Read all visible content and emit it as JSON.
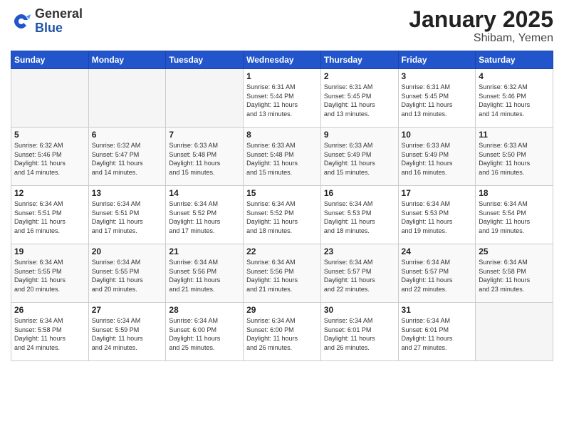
{
  "logo": {
    "general": "General",
    "blue": "Blue"
  },
  "header": {
    "month": "January 2025",
    "location": "Shibam, Yemen"
  },
  "weekdays": [
    "Sunday",
    "Monday",
    "Tuesday",
    "Wednesday",
    "Thursday",
    "Friday",
    "Saturday"
  ],
  "weeks": [
    [
      {
        "day": "",
        "info": ""
      },
      {
        "day": "",
        "info": ""
      },
      {
        "day": "",
        "info": ""
      },
      {
        "day": "1",
        "info": "Sunrise: 6:31 AM\nSunset: 5:44 PM\nDaylight: 11 hours\nand 13 minutes."
      },
      {
        "day": "2",
        "info": "Sunrise: 6:31 AM\nSunset: 5:45 PM\nDaylight: 11 hours\nand 13 minutes."
      },
      {
        "day": "3",
        "info": "Sunrise: 6:31 AM\nSunset: 5:45 PM\nDaylight: 11 hours\nand 13 minutes."
      },
      {
        "day": "4",
        "info": "Sunrise: 6:32 AM\nSunset: 5:46 PM\nDaylight: 11 hours\nand 14 minutes."
      }
    ],
    [
      {
        "day": "5",
        "info": "Sunrise: 6:32 AM\nSunset: 5:46 PM\nDaylight: 11 hours\nand 14 minutes."
      },
      {
        "day": "6",
        "info": "Sunrise: 6:32 AM\nSunset: 5:47 PM\nDaylight: 11 hours\nand 14 minutes."
      },
      {
        "day": "7",
        "info": "Sunrise: 6:33 AM\nSunset: 5:48 PM\nDaylight: 11 hours\nand 15 minutes."
      },
      {
        "day": "8",
        "info": "Sunrise: 6:33 AM\nSunset: 5:48 PM\nDaylight: 11 hours\nand 15 minutes."
      },
      {
        "day": "9",
        "info": "Sunrise: 6:33 AM\nSunset: 5:49 PM\nDaylight: 11 hours\nand 15 minutes."
      },
      {
        "day": "10",
        "info": "Sunrise: 6:33 AM\nSunset: 5:49 PM\nDaylight: 11 hours\nand 16 minutes."
      },
      {
        "day": "11",
        "info": "Sunrise: 6:33 AM\nSunset: 5:50 PM\nDaylight: 11 hours\nand 16 minutes."
      }
    ],
    [
      {
        "day": "12",
        "info": "Sunrise: 6:34 AM\nSunset: 5:51 PM\nDaylight: 11 hours\nand 16 minutes."
      },
      {
        "day": "13",
        "info": "Sunrise: 6:34 AM\nSunset: 5:51 PM\nDaylight: 11 hours\nand 17 minutes."
      },
      {
        "day": "14",
        "info": "Sunrise: 6:34 AM\nSunset: 5:52 PM\nDaylight: 11 hours\nand 17 minutes."
      },
      {
        "day": "15",
        "info": "Sunrise: 6:34 AM\nSunset: 5:52 PM\nDaylight: 11 hours\nand 18 minutes."
      },
      {
        "day": "16",
        "info": "Sunrise: 6:34 AM\nSunset: 5:53 PM\nDaylight: 11 hours\nand 18 minutes."
      },
      {
        "day": "17",
        "info": "Sunrise: 6:34 AM\nSunset: 5:53 PM\nDaylight: 11 hours\nand 19 minutes."
      },
      {
        "day": "18",
        "info": "Sunrise: 6:34 AM\nSunset: 5:54 PM\nDaylight: 11 hours\nand 19 minutes."
      }
    ],
    [
      {
        "day": "19",
        "info": "Sunrise: 6:34 AM\nSunset: 5:55 PM\nDaylight: 11 hours\nand 20 minutes."
      },
      {
        "day": "20",
        "info": "Sunrise: 6:34 AM\nSunset: 5:55 PM\nDaylight: 11 hours\nand 20 minutes."
      },
      {
        "day": "21",
        "info": "Sunrise: 6:34 AM\nSunset: 5:56 PM\nDaylight: 11 hours\nand 21 minutes."
      },
      {
        "day": "22",
        "info": "Sunrise: 6:34 AM\nSunset: 5:56 PM\nDaylight: 11 hours\nand 21 minutes."
      },
      {
        "day": "23",
        "info": "Sunrise: 6:34 AM\nSunset: 5:57 PM\nDaylight: 11 hours\nand 22 minutes."
      },
      {
        "day": "24",
        "info": "Sunrise: 6:34 AM\nSunset: 5:57 PM\nDaylight: 11 hours\nand 22 minutes."
      },
      {
        "day": "25",
        "info": "Sunrise: 6:34 AM\nSunset: 5:58 PM\nDaylight: 11 hours\nand 23 minutes."
      }
    ],
    [
      {
        "day": "26",
        "info": "Sunrise: 6:34 AM\nSunset: 5:58 PM\nDaylight: 11 hours\nand 24 minutes."
      },
      {
        "day": "27",
        "info": "Sunrise: 6:34 AM\nSunset: 5:59 PM\nDaylight: 11 hours\nand 24 minutes."
      },
      {
        "day": "28",
        "info": "Sunrise: 6:34 AM\nSunset: 6:00 PM\nDaylight: 11 hours\nand 25 minutes."
      },
      {
        "day": "29",
        "info": "Sunrise: 6:34 AM\nSunset: 6:00 PM\nDaylight: 11 hours\nand 26 minutes."
      },
      {
        "day": "30",
        "info": "Sunrise: 6:34 AM\nSunset: 6:01 PM\nDaylight: 11 hours\nand 26 minutes."
      },
      {
        "day": "31",
        "info": "Sunrise: 6:34 AM\nSunset: 6:01 PM\nDaylight: 11 hours\nand 27 minutes."
      },
      {
        "day": "",
        "info": ""
      }
    ]
  ]
}
